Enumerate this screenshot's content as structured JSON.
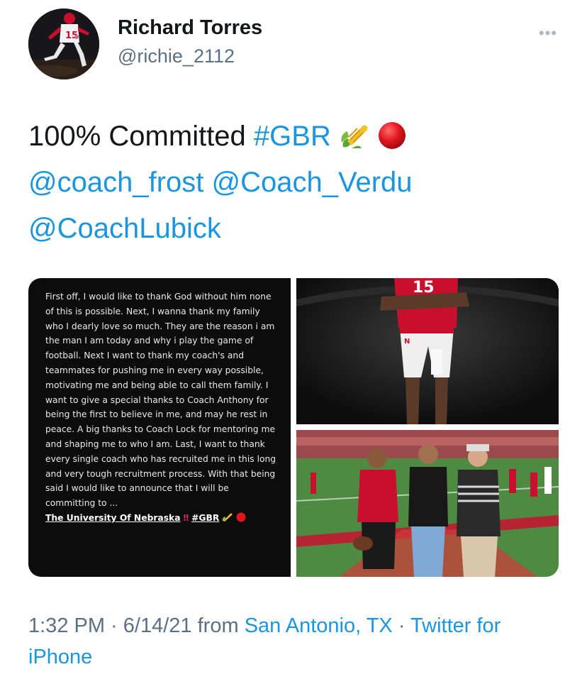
{
  "user": {
    "display_name": "Richard Torres",
    "handle": "@richie_2112",
    "jersey_number": "15"
  },
  "more_icon": "•••",
  "tweet": {
    "text": "100% Committed",
    "hashtag": "#GBR",
    "emojis": [
      "corn-icon",
      "red-circle-icon"
    ],
    "mentions": [
      "@coach_frost",
      "@Coach_Verdu",
      "@CoachLubick"
    ]
  },
  "media": {
    "story_text": "First off, I would like to thank God without him none of this is possible. Next, I wanna thank my family who I dearly love so much. They are the reason i am the man I am today and why i play the game of football. Next I want to thank my coach's and teammates for pushing me in every way possible, motivating me and being able to call them family. I want to give a special thanks to Coach Anthony for being the first to believe in me, and may he rest in peace. A big thanks to Coach Lock for mentoring me and shaping me to who I am. Last, I want to thank every single coach who has recruited me in this long and very tough recruitment process. With that being said I would like to announce that I will be committing to ...",
    "story_final": "The University Of Nebraska",
    "story_excl": "‼",
    "story_tag": "#GBR",
    "photo_top_jersey": "15"
  },
  "meta": {
    "time": "1:32 PM",
    "sep": "·",
    "date": "6/14/21",
    "from": "from",
    "location": "San Antonio, TX",
    "client": "Twitter for iPhone"
  },
  "colors": {
    "link": "#1b95e0",
    "secondary": "#5b7083",
    "nebraska_red": "#d00000"
  }
}
